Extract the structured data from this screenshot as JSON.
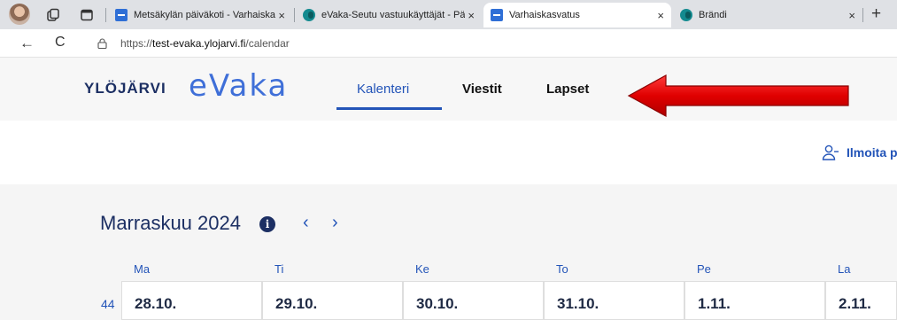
{
  "browser": {
    "tabs": [
      {
        "label": "Metsäkylän päiväkoti - Varhaiskas",
        "close": "×"
      },
      {
        "label": "eVaka-Seutu vastuukäyttäjät - Pää",
        "close": "×"
      },
      {
        "label": "Varhaiskasvatus",
        "close": "×"
      },
      {
        "label": "Brändi",
        "close": "×"
      }
    ],
    "new_tab": "+",
    "back": "←",
    "reload": "C",
    "url_prefix": "https://",
    "url_host": "test-evaka.ylojarvi.fi",
    "url_path": "/calendar"
  },
  "header": {
    "brand_city": "YLÖJÄRVI",
    "brand_product": "eVaka",
    "nav": [
      "Kalenteri",
      "Viestit",
      "Lapset"
    ],
    "active_nav": "Kalenteri"
  },
  "actions": {
    "notify_label": "Ilmoita p"
  },
  "calendar": {
    "month": "Marraskuu 2024",
    "info_symbol": "i",
    "prev": "‹",
    "next": "›",
    "weekdays": [
      "Ma",
      "Ti",
      "Ke",
      "To",
      "Pe",
      "La"
    ],
    "week_number": "44",
    "dates": [
      "28.10.",
      "29.10.",
      "30.10.",
      "31.10.",
      "1.11.",
      "2.11."
    ]
  },
  "colors": {
    "brand_blue": "#2354b8",
    "dark_navy": "#1c2f63",
    "arrow_red": "#e00000"
  }
}
